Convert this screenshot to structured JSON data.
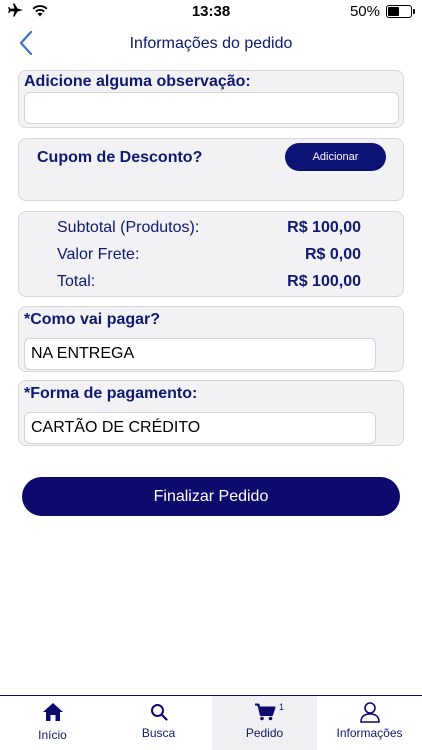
{
  "status_bar": {
    "time": "13:38",
    "battery": "50%",
    "battery_level": 0.5
  },
  "header": {
    "title": "Informações do pedido"
  },
  "observation": {
    "label": "Adicione alguma observação:",
    "value": ""
  },
  "coupon": {
    "label": "Cupom de Desconto?",
    "button": "Adicionar"
  },
  "summary": {
    "subtotal_label": "Subtotal (Produtos):",
    "subtotal_value": "R$ 100,00",
    "shipping_label": "Valor Frete:",
    "shipping_value": "R$ 0,00",
    "total_label": "Total:",
    "total_value": "R$ 100,00"
  },
  "payment_when": {
    "label": "*Como vai pagar?",
    "value": "NA ENTREGA"
  },
  "payment_method": {
    "label": "*Forma de pagamento:",
    "value": "CARTÃO DE CRÉDITO"
  },
  "finalize": {
    "label": "Finalizar Pedido"
  },
  "tabs": [
    {
      "label": "Início",
      "icon": "home-icon"
    },
    {
      "label": "Busca",
      "icon": "search-icon"
    },
    {
      "label": "Pedido",
      "icon": "cart-icon",
      "badge": "1"
    },
    {
      "label": "Informações",
      "icon": "user-icon"
    }
  ],
  "colors": {
    "primary": "#0d0a6e",
    "card_bg": "#f2f2f4",
    "text_blue": "#0d1a6e"
  }
}
